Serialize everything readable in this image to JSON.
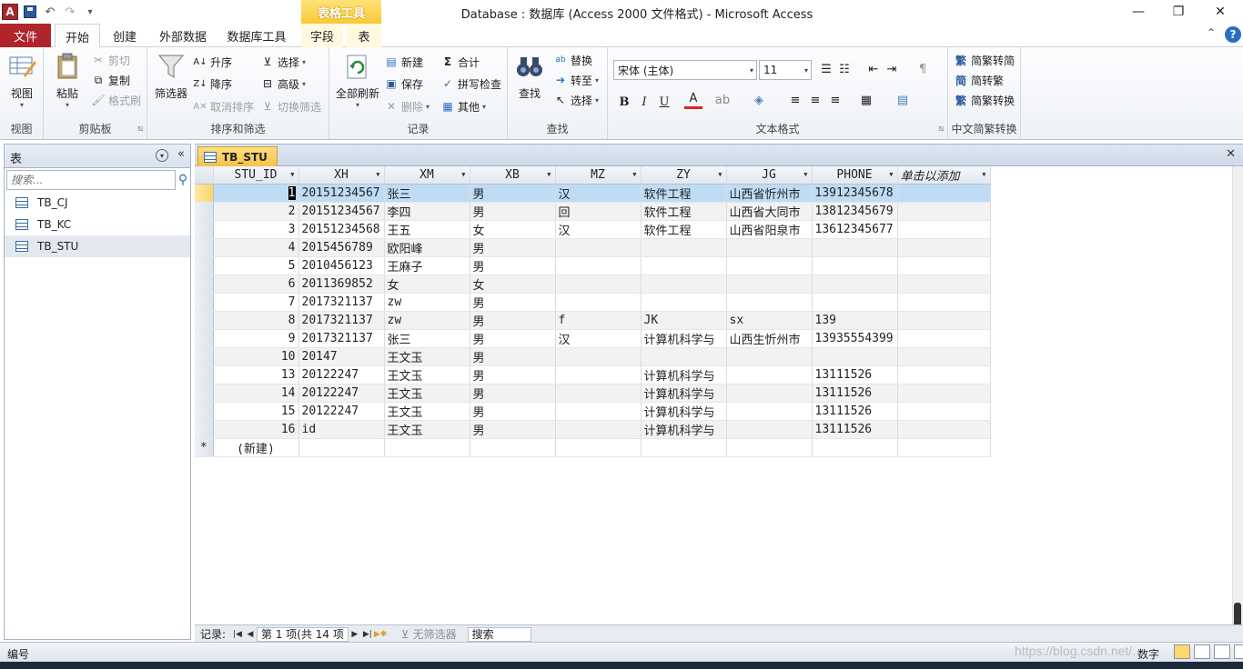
{
  "window": {
    "title": "Database : 数据库 (Access 2000 文件格式)  - Microsoft Access",
    "context_tab_title": "表格工具"
  },
  "ribbon_tabs": [
    "文件",
    "开始",
    "创建",
    "外部数据",
    "数据库工具",
    "字段",
    "表"
  ],
  "ribbon": {
    "views": {
      "view_label": "视图",
      "group": "视图"
    },
    "clipboard": {
      "paste": "粘贴",
      "cut": "剪切",
      "copy": "复制",
      "format_painter": "格式刷",
      "group": "剪贴板"
    },
    "sort_filter": {
      "filter": "筛选器",
      "asc": "升序",
      "desc": "降序",
      "clear_sort": "取消排序",
      "select": "选择",
      "advanced": "高级",
      "toggle_filter": "切换筛选",
      "group": "排序和筛选"
    },
    "records": {
      "refresh_all": "全部刷新",
      "new": "新建",
      "save": "保存",
      "delete": "删除",
      "totals": "合计",
      "spelling": "拼写检查",
      "more": "其他",
      "group": "记录"
    },
    "find": {
      "find": "查找",
      "replace": "替换",
      "goto": "转至",
      "select": "选择",
      "group": "查找"
    },
    "text_format": {
      "font": "宋体 (主体)",
      "size": "11",
      "bold": "B",
      "italic": "I",
      "underline": "U",
      "group": "文本格式"
    },
    "chinese": {
      "to_traditional": "简繁转简",
      "to_simplified": "简转繁",
      "convert": "简繁转换",
      "group": "中文简繁转换"
    }
  },
  "nav_pane": {
    "title": "表",
    "search_placeholder": "搜索...",
    "items": [
      {
        "label": "TB_CJ"
      },
      {
        "label": "TB_KC"
      },
      {
        "label": "TB_STU"
      }
    ]
  },
  "document": {
    "tab_label": "TB_STU",
    "columns": [
      "STU_ID",
      "XH",
      "XM",
      "XB",
      "MZ",
      "ZY",
      "JG",
      "PHONE",
      "单击以添加"
    ],
    "rows": [
      [
        "1",
        "20151234567",
        "张三",
        "男",
        "汉",
        "软件工程",
        "山西省忻州市",
        "13912345678"
      ],
      [
        "2",
        "20151234567",
        "李四",
        "男",
        "回",
        "软件工程",
        "山西省大同市",
        "13812345679"
      ],
      [
        "3",
        "20151234568",
        "王五",
        "女",
        "汉",
        "软件工程",
        "山西省阳泉市",
        "13612345677"
      ],
      [
        "4",
        "2015456789",
        "欧阳峰",
        "男",
        "",
        "",
        "",
        ""
      ],
      [
        "5",
        "2010456123",
        "王麻子",
        "男",
        "",
        "",
        "",
        ""
      ],
      [
        "6",
        "2011369852",
        "女",
        "女",
        "",
        "",
        "",
        ""
      ],
      [
        "7",
        "2017321137",
        "zw",
        "男",
        "",
        "",
        "",
        ""
      ],
      [
        "8",
        "2017321137",
        "zw",
        "男",
        "f",
        "JK",
        "sx",
        "139"
      ],
      [
        "9",
        "2017321137",
        "张三",
        "男",
        "汉",
        "计算机科学与",
        "山西生忻州市",
        "13935554399"
      ],
      [
        "10",
        "20147",
        "王文玉",
        "男",
        "",
        "",
        "",
        ""
      ],
      [
        "13",
        "20122247",
        "王文玉",
        "男",
        "",
        "计算机科学与",
        "",
        "13111526"
      ],
      [
        "14",
        "20122247",
        "王文玉",
        "男",
        "",
        "计算机科学与",
        "",
        "13111526"
      ],
      [
        "15",
        "20122247",
        "王文玉",
        "男",
        "",
        "计算机科学与",
        "",
        "13111526"
      ],
      [
        "16",
        "id",
        "王文玉",
        "男",
        "",
        "计算机科学与",
        "",
        "13111526"
      ]
    ],
    "new_row_label": "(新建)",
    "record_nav": {
      "label": "记录:",
      "position": "第 1 项(共 14 项",
      "filter": "无筛选器",
      "search": "搜索"
    }
  },
  "status_bar": {
    "left": "编号",
    "right": "数字"
  },
  "watermark": "https://blog.csdn.net/..."
}
